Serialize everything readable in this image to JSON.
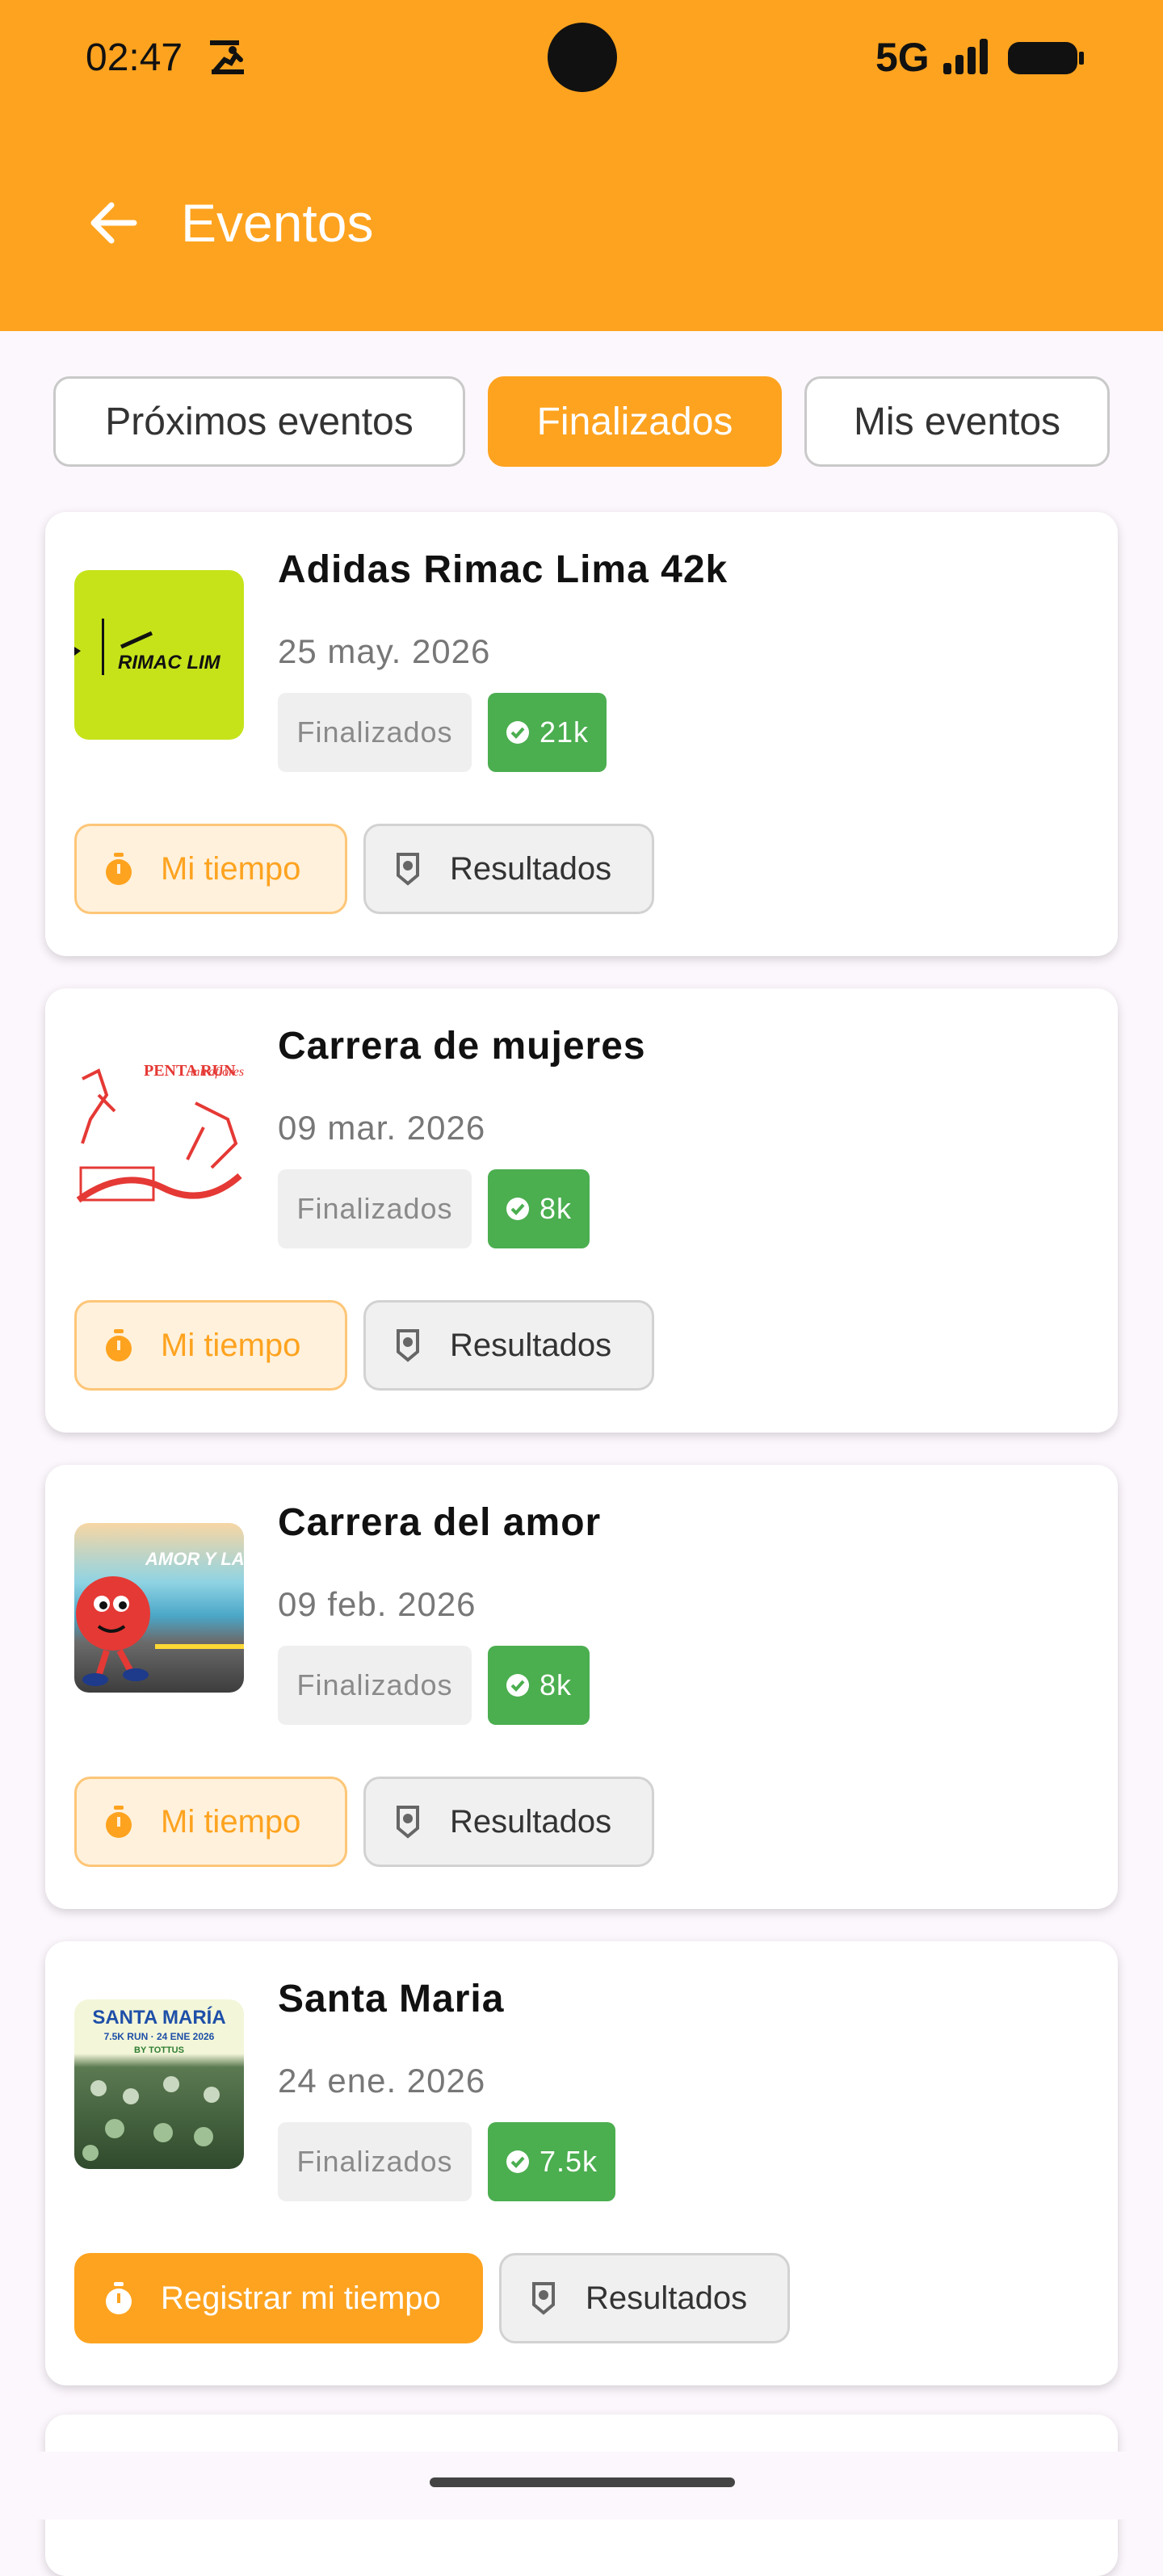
{
  "status_bar": {
    "time": "02:47",
    "network": "5G",
    "icons": [
      "runner-notification-icon",
      "signal-icon",
      "battery-icon"
    ]
  },
  "header": {
    "title": "Eventos",
    "back_icon": "arrow-left-icon"
  },
  "tabs": [
    {
      "label": "Próximos eventos",
      "active": false
    },
    {
      "label": "Finalizados",
      "active": true
    },
    {
      "label": "Mis eventos",
      "active": false
    }
  ],
  "events": [
    {
      "name": "Adidas Rimac Lima 42k",
      "date": "25 may. 2026",
      "status": "Finalizados",
      "distance": "21k",
      "thumb_text": "RIMAC LIM",
      "action_label": "Mi tiempo",
      "results_label": "Resultados"
    },
    {
      "name": "Carrera de mujeres",
      "date": "09 mar. 2026",
      "status": "Finalizados",
      "distance": "8k",
      "thumb_text": "PENTA RUN",
      "thumb_text2": "miraflores",
      "action_label": "Mi tiempo",
      "results_label": "Resultados"
    },
    {
      "name": "Carrera del amor",
      "date": "09 feb. 2026",
      "status": "Finalizados",
      "distance": "8k",
      "thumb_text": "AMOR Y LA",
      "action_label": "Mi tiempo",
      "results_label": "Resultados"
    },
    {
      "name": "Santa Maria",
      "date": "24 ene. 2026",
      "status": "Finalizados",
      "distance": "7.5k",
      "thumb_text": "SANTA MARÍA",
      "thumb_text2": "7.5K RUN · 24 ENE 2026",
      "thumb_text3": "BY TOTTUS",
      "action_label": "Registrar mi tiempo",
      "results_label": "Resultados"
    }
  ],
  "colors": {
    "primary": "#fea31f",
    "success": "#4bae4f",
    "background": "#fcf7fc"
  }
}
